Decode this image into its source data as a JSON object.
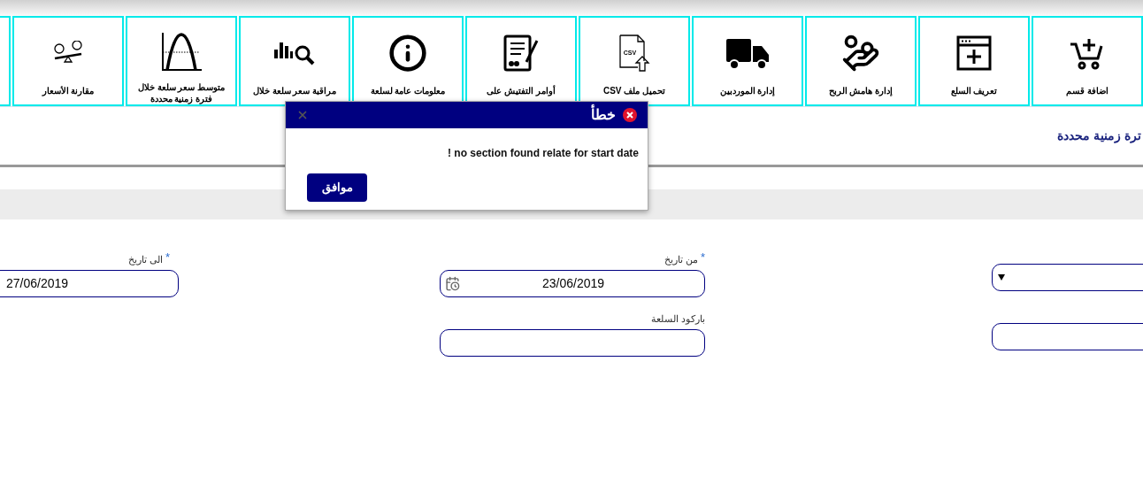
{
  "toolbar": {
    "tiles": [
      {
        "label": "اضافة قسم"
      },
      {
        "label": "تعريف السلع"
      },
      {
        "label": "إدارة هامش الربح"
      },
      {
        "label": "إدارة الموردبين"
      },
      {
        "label": "تحميل ملف CSV",
        "icon_text": "CSV"
      },
      {
        "label": "أوامر التفتيش على"
      },
      {
        "label": "معلومات عامة لسلعة"
      },
      {
        "label": "مراقبة سعر سلعة خلال"
      },
      {
        "label": "متوسط سعر سلعة خلال فترة زمنية محددة"
      },
      {
        "label": "مقارنة الأسعار"
      }
    ]
  },
  "page_title": "ترة زمنية محددة",
  "form": {
    "right_column": [
      {
        "kind": "select"
      },
      {
        "kind": "text"
      }
    ],
    "middle_column": [
      {
        "kind": "date",
        "label": "من تاريخ",
        "required_mark": "*",
        "value": "23/06/2019"
      },
      {
        "kind": "text",
        "label": "باركود السلعة"
      }
    ],
    "left_column": [
      {
        "kind": "date_plain",
        "label": "الى تاريخ",
        "required_mark": "*",
        "value": "27/06/2019"
      }
    ]
  },
  "dialog": {
    "title": "خطأ",
    "message": "! no section found relate for start date",
    "button": "موافق"
  }
}
